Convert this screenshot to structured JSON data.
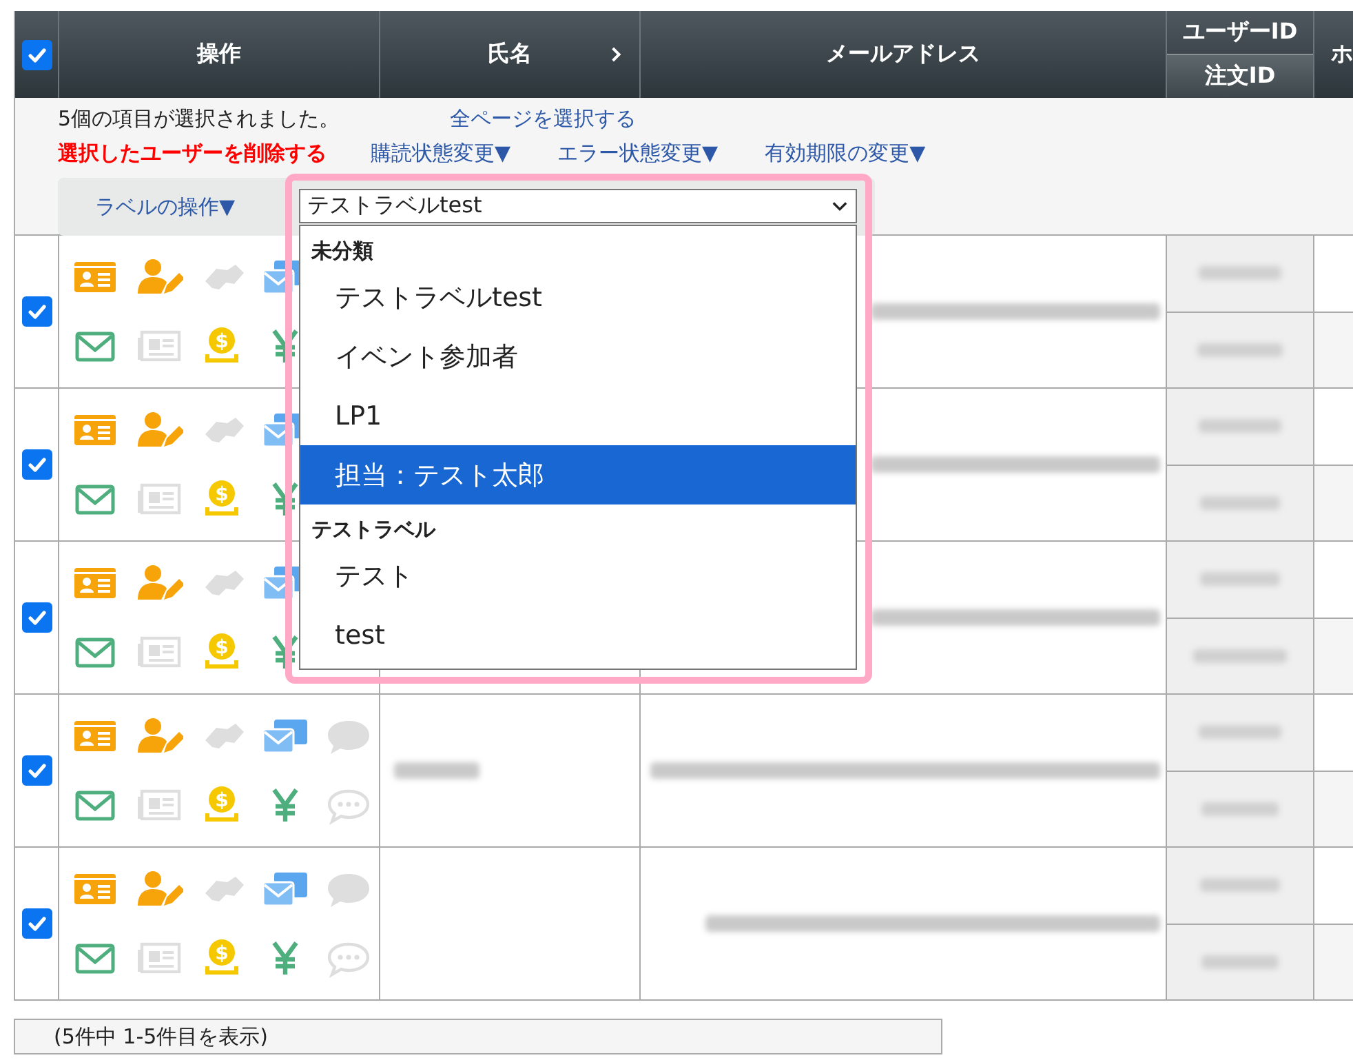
{
  "header": {
    "select_all_checked": true,
    "columns": [
      {
        "label": "操作",
        "kind": "plain"
      },
      {
        "label": "氏名",
        "kind": "sortable"
      },
      {
        "label": "メールアドレス",
        "kind": "plain"
      },
      {
        "label": "ユーザーID",
        "sub_label": "注文ID",
        "kind": "split"
      },
      {
        "label": "ホ",
        "kind": "plain"
      }
    ]
  },
  "toolbar": {
    "selection_message": "5個の項目が選択されました。",
    "select_all_link": "全ページを選択する",
    "delete_link": "選択したユーザーを削除する",
    "menus": [
      "購読状態変更▼",
      "エラー状態変更▼",
      "有効期限の変更▼"
    ],
    "label_button": "ラベルの操作▼"
  },
  "label_select": {
    "value": "テストラベルtest",
    "groups": [
      {
        "label": "未分類",
        "options": [
          {
            "label": "テストラベルtest",
            "selected": false
          },
          {
            "label": "イベント参加者",
            "selected": false
          },
          {
            "label": "LP1",
            "selected": false
          },
          {
            "label": "担当：テスト太郎",
            "selected": true
          }
        ]
      },
      {
        "label": "テストラベル",
        "options": [
          {
            "label": "テスト",
            "selected": false
          },
          {
            "label": "test",
            "selected": false
          }
        ]
      }
    ]
  },
  "action_icons": [
    {
      "kind": "card",
      "disabled": false
    },
    {
      "kind": "user-edit",
      "disabled": false
    },
    {
      "kind": "handshake",
      "disabled": true
    },
    {
      "kind": "mail-card",
      "disabled": false
    },
    {
      "kind": "chat",
      "disabled": true
    },
    {
      "kind": "mail",
      "disabled": false
    },
    {
      "kind": "newspaper",
      "disabled": true
    },
    {
      "kind": "coin",
      "disabled": false,
      "glyph": "$"
    },
    {
      "kind": "yen",
      "disabled": false
    },
    {
      "kind": "chat-dots",
      "disabled": true
    }
  ],
  "rows": [
    {
      "checked": true,
      "under_dropdown": true
    },
    {
      "checked": true,
      "under_dropdown": true
    },
    {
      "checked": true,
      "under_dropdown": true
    },
    {
      "checked": true,
      "under_dropdown": false,
      "name_blurred": true
    },
    {
      "checked": true,
      "under_dropdown": false,
      "name_blurred": false
    }
  ],
  "footer": {
    "summary": "(5件中 1-5件目を表示)"
  }
}
